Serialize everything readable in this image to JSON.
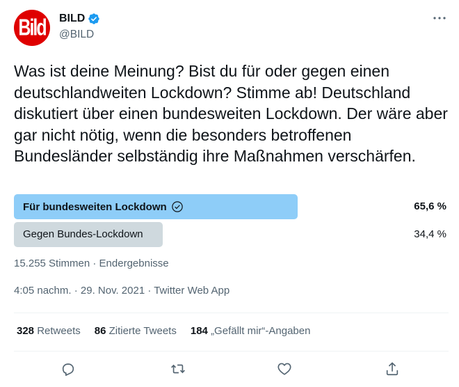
{
  "account": {
    "display_name": "BILD",
    "handle": "@BILD",
    "avatar_text": "Bild"
  },
  "tweet": {
    "text": "Was ist deine Meinung? Bist du für oder gegen einen deutschlandweiten Lockdown? Stimme ab! Deutschland diskutiert über einen bundesweiten Lockdown. Der wäre aber gar nicht nötig, wenn die besonders betroffenen Bundesländer selbständig ihre Maßnahmen verschärfen."
  },
  "poll": {
    "options": [
      {
        "label": "Für bundesweiten Lockdown",
        "percent_text": "65,6 %",
        "share": 0.656,
        "winner": true
      },
      {
        "label": "Gegen Bundes-Lockdown",
        "percent_text": "34,4 %",
        "share": 0.344,
        "winner": false
      }
    ],
    "meta": "15.255 Stimmen · Endergebnisse"
  },
  "timestamp": "4:05 nachm. · 29. Nov. 2021 · Twitter Web App",
  "stats": {
    "retweets_count": "328",
    "retweets_label": "Retweets",
    "quotes_count": "86",
    "quotes_label": "Zitierte Tweets",
    "likes_count": "184",
    "likes_label": "„Gefällt mir“-Angaben"
  },
  "colors": {
    "winner_bar": "#8ecdf8",
    "loser_bar": "#cfd9de",
    "brand_red": "#df0000",
    "verified_blue": "#1d9bf0",
    "secondary_text": "#536471"
  },
  "icons": {
    "verified": "verified-badge-icon",
    "more": "more-icon",
    "check": "check-circle-icon",
    "reply": "reply-icon",
    "retweet": "retweet-icon",
    "like": "heart-icon",
    "share": "share-icon"
  }
}
